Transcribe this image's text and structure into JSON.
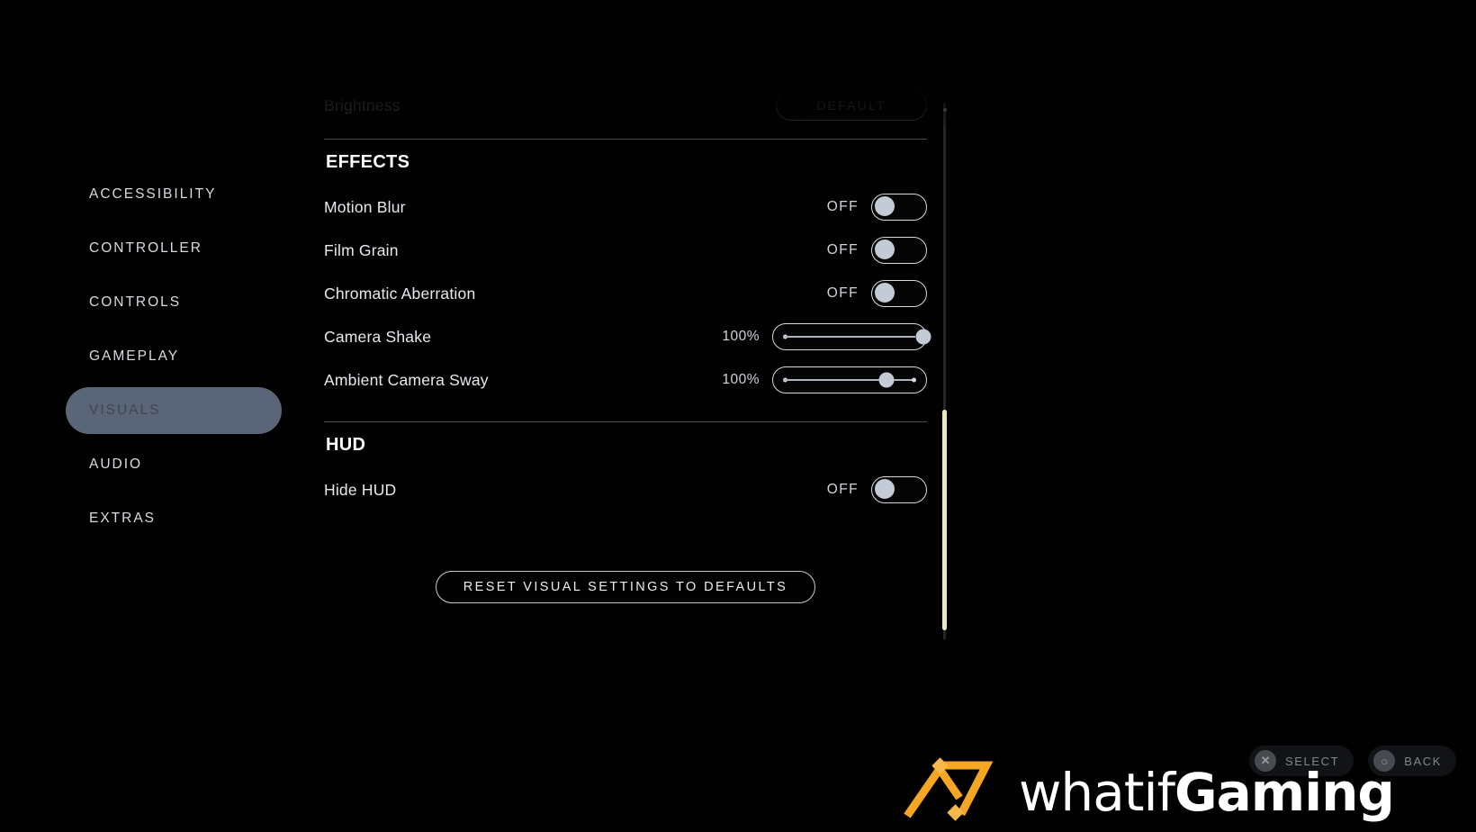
{
  "sidebar": {
    "items": [
      {
        "label": "ACCESSIBILITY",
        "active": false
      },
      {
        "label": "CONTROLLER",
        "active": false
      },
      {
        "label": "CONTROLS",
        "active": false
      },
      {
        "label": "GAMEPLAY",
        "active": false
      },
      {
        "label": "VISUALS",
        "active": true
      },
      {
        "label": "AUDIO",
        "active": false
      },
      {
        "label": "EXTRAS",
        "active": false
      }
    ]
  },
  "panel": {
    "clipped_row": {
      "label": "Brightness",
      "button_label": "DEFAULT"
    },
    "sections": [
      {
        "title": "EFFECTS",
        "rows": [
          {
            "label": "Motion Blur",
            "type": "toggle",
            "value": "OFF"
          },
          {
            "label": "Film Grain",
            "type": "toggle",
            "value": "OFF"
          },
          {
            "label": "Chromatic Aberration",
            "type": "toggle",
            "value": "OFF"
          },
          {
            "label": "Camera Shake",
            "type": "slider",
            "value": "100%",
            "percent": 100
          },
          {
            "label": "Ambient Camera Sway",
            "type": "slider",
            "value": "100%",
            "percent": 72
          }
        ]
      },
      {
        "title": "HUD",
        "rows": [
          {
            "label": "Hide HUD",
            "type": "toggle",
            "value": "OFF"
          }
        ]
      }
    ],
    "reset_button": "RESET VISUAL SETTINGS TO DEFAULTS"
  },
  "prompts": [
    {
      "glyph": "✕",
      "label": "SELECT",
      "icon": "cross-button-icon"
    },
    {
      "glyph": "○",
      "label": "BACK",
      "icon": "circle-button-icon"
    }
  ],
  "watermark": {
    "text_light": "whatif",
    "text_bold": "Gaming",
    "logo_color": "#F5A623"
  },
  "colors": {
    "background": "#010101",
    "active_nav": "#5a6678",
    "active_nav_text": "#3c4654",
    "text_primary": "#e6e9ee",
    "divider": "#4a4d52",
    "scrollbar_thumb": "#e8e7c0",
    "knob": "#c3cbd6"
  }
}
